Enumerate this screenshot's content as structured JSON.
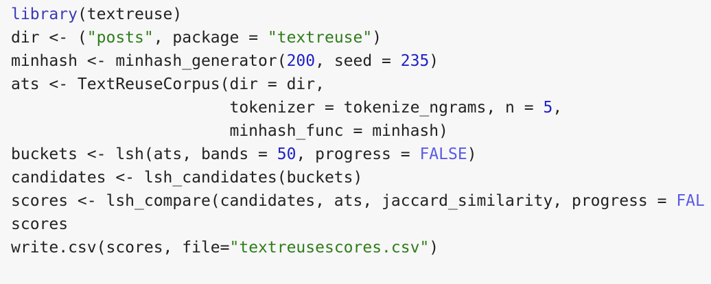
{
  "editor": {
    "language": "R",
    "colors": {
      "background": "#f7f7f7",
      "default_text": "#222222",
      "function": "#3a3ab8",
      "string": "#2e7d1a",
      "number": "#1f1fc8",
      "constant": "#5a5ae6"
    },
    "lines": [
      [
        {
          "t": "library",
          "c": "fn"
        },
        {
          "t": "(textreuse)",
          "c": "plain"
        }
      ],
      [
        {
          "t": "dir <- (",
          "c": "plain"
        },
        {
          "t": "\"posts\"",
          "c": "str"
        },
        {
          "t": ", package = ",
          "c": "plain"
        },
        {
          "t": "\"textreuse\"",
          "c": "str"
        },
        {
          "t": ")",
          "c": "plain"
        }
      ],
      [
        {
          "t": "minhash <- minhash_generator(",
          "c": "plain"
        },
        {
          "t": "200",
          "c": "num"
        },
        {
          "t": ", seed = ",
          "c": "plain"
        },
        {
          "t": "235",
          "c": "num"
        },
        {
          "t": ")",
          "c": "plain"
        }
      ],
      [
        {
          "t": "ats <- TextReuseCorpus(dir = dir,",
          "c": "plain"
        }
      ],
      [
        {
          "t": "                       tokenizer = tokenize_ngrams, n = ",
          "c": "plain"
        },
        {
          "t": "5",
          "c": "num"
        },
        {
          "t": ",",
          "c": "plain"
        }
      ],
      [
        {
          "t": "                       minhash_func = minhash)",
          "c": "plain"
        }
      ],
      [
        {
          "t": "buckets <- lsh(ats, bands = ",
          "c": "plain"
        },
        {
          "t": "50",
          "c": "num"
        },
        {
          "t": ", progress = ",
          "c": "plain"
        },
        {
          "t": "FALSE",
          "c": "const"
        },
        {
          "t": ")",
          "c": "plain"
        }
      ],
      [
        {
          "t": "candidates <- lsh_candidates(buckets)",
          "c": "plain"
        }
      ],
      [
        {
          "t": "scores <- lsh_compare(candidates, ats, jaccard_similarity, progress = ",
          "c": "plain"
        },
        {
          "t": "FAL",
          "c": "const"
        }
      ],
      [
        {
          "t": "scores",
          "c": "plain"
        }
      ],
      [
        {
          "t": "write.csv(scores, file=",
          "c": "plain"
        },
        {
          "t": "\"textreusescores.csv\"",
          "c": "str"
        },
        {
          "t": ")",
          "c": "plain"
        }
      ]
    ]
  }
}
